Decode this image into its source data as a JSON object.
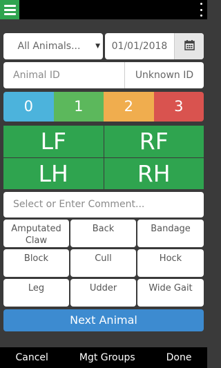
{
  "topbar": {
    "menu_icon": "hamburger-menu-icon",
    "overflow_icon": "vertical-ellipsis-icon",
    "menu_color": "#2fa44f"
  },
  "filter": {
    "animal_group": "All Animals...",
    "date": "01/01/2018",
    "calendar_icon": "calendar-icon"
  },
  "id_row": {
    "animal_id_placeholder": "Animal ID",
    "unknown_label": "Unknown ID"
  },
  "scores": [
    {
      "label": "0",
      "color": "#4cb3dc"
    },
    {
      "label": "1",
      "color": "#5cb85c"
    },
    {
      "label": "2",
      "color": "#f0ad4e"
    },
    {
      "label": "3",
      "color": "#d9534f"
    }
  ],
  "legs": [
    "LF",
    "RF",
    "LH",
    "RH"
  ],
  "comment": {
    "placeholder": "Select or Enter Comment..."
  },
  "comment_options": [
    "Amputated Claw",
    "Back",
    "Bandage",
    "Block",
    "Cull",
    "Hock",
    "Leg",
    "Udder",
    "Wide Gait"
  ],
  "next_button": "Next Animal",
  "bottom_nav": [
    "Cancel",
    "Mgt Groups",
    "Done"
  ]
}
